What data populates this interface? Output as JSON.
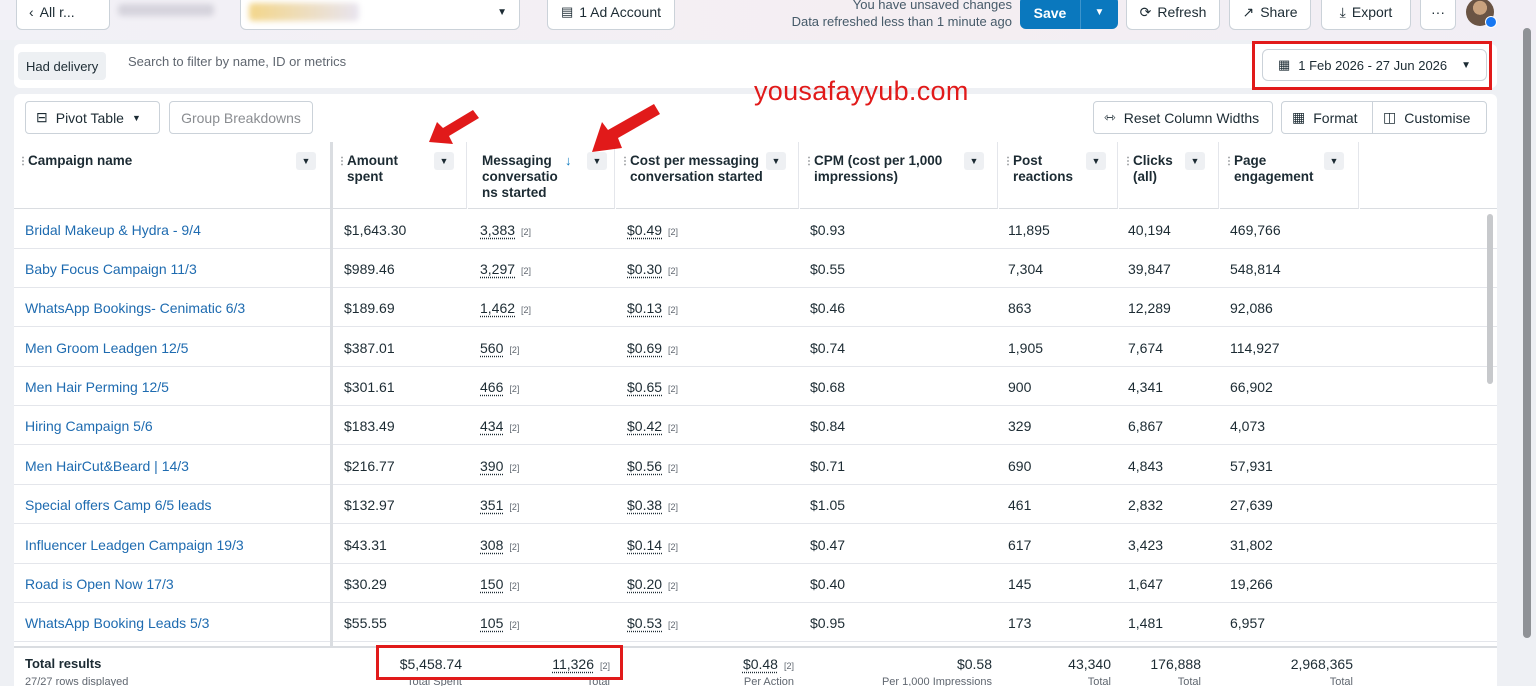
{
  "topbar": {
    "back_label": "All r...",
    "ad_account_label": "1 Ad Account",
    "unsaved_text": "You have unsaved changes",
    "refreshed_text": "Data refreshed less than 1 minute ago",
    "save_label": "Save",
    "refresh_label": "Refresh",
    "share_label": "Share",
    "export_label": "Export",
    "more_label": "···"
  },
  "filter": {
    "chip_label": "Had delivery",
    "placeholder": "Search to filter by name, ID or metrics",
    "date_range": "1 Feb 2026 - 27 Jun 2026"
  },
  "watermark": "yousafayyub.com",
  "toolbar": {
    "pivot_label": "Pivot Table",
    "group_label": "Group Breakdowns",
    "reset_label": "Reset Column Widths",
    "format_label": "Format",
    "customise_label": "Customise"
  },
  "columns": {
    "campaign": "Campaign name",
    "amount_1": "Amount",
    "amount_2": "spent",
    "msg_1": "Messaging",
    "msg_2": "conversatio",
    "msg_3": "ns started",
    "cost_1": "Cost per messaging",
    "cost_2": "conversation started",
    "cpm_1": "CPM (cost per 1,000",
    "cpm_2": "impressions)",
    "post_1": "Post",
    "post_2": "reactions",
    "clicks_1": "Clicks",
    "clicks_2": "(all)",
    "page_1": "Page",
    "page_2": "engagement"
  },
  "rows": [
    {
      "name": "Bridal Makeup & Hydra - 9/4",
      "spent": "$1,643.30",
      "msgs": "3,383",
      "msg_tag": "[2]",
      "cost": "$0.49",
      "cost_tag": "[2]",
      "cpm": "$0.93",
      "reactions": "11,895",
      "clicks": "40,194",
      "engagement": "469,766"
    },
    {
      "name": "Baby Focus Campaign 11/3",
      "spent": "$989.46",
      "msgs": "3,297",
      "msg_tag": "[2]",
      "cost": "$0.30",
      "cost_tag": "[2]",
      "cpm": "$0.55",
      "reactions": "7,304",
      "clicks": "39,847",
      "engagement": "548,814"
    },
    {
      "name": "WhatsApp Bookings- Cenimatic 6/3",
      "spent": "$189.69",
      "msgs": "1,462",
      "msg_tag": "[2]",
      "cost": "$0.13",
      "cost_tag": "[2]",
      "cpm": "$0.46",
      "reactions": "863",
      "clicks": "12,289",
      "engagement": "92,086"
    },
    {
      "name": "Men Groom Leadgen 12/5",
      "spent": "$387.01",
      "msgs": "560",
      "msg_tag": "[2]",
      "cost": "$0.69",
      "cost_tag": "[2]",
      "cpm": "$0.74",
      "reactions": "1,905",
      "clicks": "7,674",
      "engagement": "114,927"
    },
    {
      "name": "Men Hair Perming 12/5",
      "spent": "$301.61",
      "msgs": "466",
      "msg_tag": "[2]",
      "cost": "$0.65",
      "cost_tag": "[2]",
      "cpm": "$0.68",
      "reactions": "900",
      "clicks": "4,341",
      "engagement": "66,902"
    },
    {
      "name": "Hiring Campaign 5/6",
      "spent": "$183.49",
      "msgs": "434",
      "msg_tag": "[2]",
      "cost": "$0.42",
      "cost_tag": "[2]",
      "cpm": "$0.84",
      "reactions": "329",
      "clicks": "6,867",
      "engagement": "4,073"
    },
    {
      "name": "Men HairCut&Beard | 14/3",
      "spent": "$216.77",
      "msgs": "390",
      "msg_tag": "[2]",
      "cost": "$0.56",
      "cost_tag": "[2]",
      "cpm": "$0.71",
      "reactions": "690",
      "clicks": "4,843",
      "engagement": "57,931"
    },
    {
      "name": "Special offers Camp 6/5 leads",
      "spent": "$132.97",
      "msgs": "351",
      "msg_tag": "[2]",
      "cost": "$0.38",
      "cost_tag": "[2]",
      "cpm": "$1.05",
      "reactions": "461",
      "clicks": "2,832",
      "engagement": "27,639"
    },
    {
      "name": "Influencer Leadgen Campaign 19/3",
      "spent": "$43.31",
      "msgs": "308",
      "msg_tag": "[2]",
      "cost": "$0.14",
      "cost_tag": "[2]",
      "cpm": "$0.47",
      "reactions": "617",
      "clicks": "3,423",
      "engagement": "31,802"
    },
    {
      "name": "Road is Open Now 17/3",
      "spent": "$30.29",
      "msgs": "150",
      "msg_tag": "[2]",
      "cost": "$0.20",
      "cost_tag": "[2]",
      "cpm": "$0.40",
      "reactions": "145",
      "clicks": "1,647",
      "engagement": "19,266"
    },
    {
      "name": "WhatsApp Booking Leads 5/3",
      "spent": "$55.55",
      "msgs": "105",
      "msg_tag": "[2]",
      "cost": "$0.53",
      "cost_tag": "[2]",
      "cpm": "$0.95",
      "reactions": "173",
      "clicks": "1,481",
      "engagement": "6,957"
    }
  ],
  "totals": {
    "label": "Total results",
    "rows_displayed": "27/27 rows displayed",
    "spent": "$5,458.74",
    "spent_sub": "Total Spent",
    "msgs": "11,326",
    "msgs_tag": "[2]",
    "msgs_sub": "Total",
    "cost": "$0.48",
    "cost_tag": "[2]",
    "cost_sub": "Per Action",
    "cpm": "$0.58",
    "cpm_sub": "Per 1,000 Impressions",
    "reactions": "43,340",
    "reactions_sub": "Total",
    "clicks": "176,888",
    "clicks_sub": "Total",
    "engagement": "2,968,365",
    "engagement_sub": "Total"
  },
  "colors": {
    "link": "#1e6bb0",
    "primary": "#0a78be",
    "annotation": "#e11a1a"
  }
}
